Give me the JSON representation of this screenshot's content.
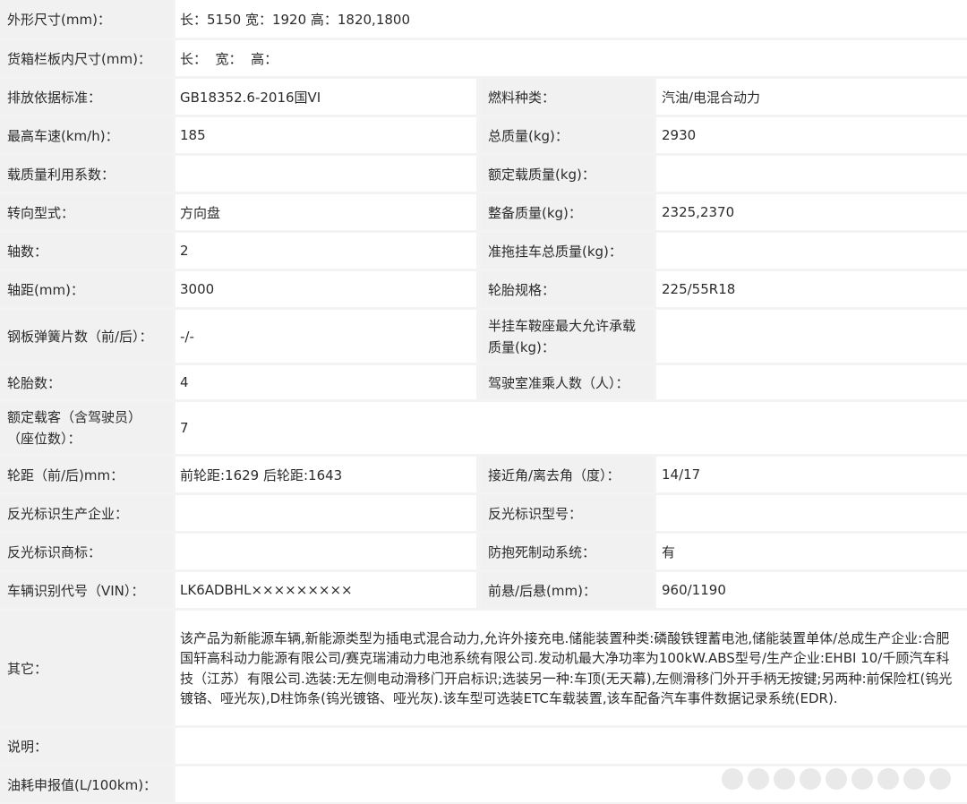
{
  "rows": [
    {
      "label": "外形尺寸(mm)：",
      "value": "长：5150 宽：1920 高：1820,1800"
    },
    {
      "label": "货箱栏板内尺寸(mm)：",
      "value": "长：  宽：  高："
    },
    {
      "label": "排放依据标准：",
      "value": "GB18352.6-2016国VI",
      "label2": "燃料种类：",
      "value2": "汽油/电混合动力"
    },
    {
      "label": "最高车速(km/h)：",
      "value": "185",
      "label2": "总质量(kg)：",
      "value2": "2930"
    },
    {
      "label": "载质量利用系数：",
      "value": "",
      "label2": "额定载质量(kg)：",
      "value2": ""
    },
    {
      "label": "转向型式：",
      "value": "方向盘",
      "label2": "整备质量(kg)：",
      "value2": "2325,2370"
    },
    {
      "label": "轴数：",
      "value": "2",
      "label2": "准拖挂车总质量(kg)：",
      "value2": ""
    },
    {
      "label": "轴距(mm)：",
      "value": "3000",
      "label2": "轮胎规格：",
      "value2": "225/55R18"
    },
    {
      "label": "钢板弹簧片数（前/后）：",
      "value": "-/-",
      "label2": "半挂车鞍座最大允许承载\n质量(kg)：",
      "value2": ""
    },
    {
      "label": "轮胎数：",
      "value": "4",
      "label2": "驾驶室准乘人数（人）：",
      "value2": ""
    },
    {
      "label": "额定载客（含驾驶员）\n（座位数）：",
      "value": "7"
    },
    {
      "label": "轮距（前/后)mm：",
      "value": "前轮距:1629 后轮距:1643",
      "label2": "接近角/离去角（度）：",
      "value2": "14/17"
    },
    {
      "label": "反光标识生产企业：",
      "value": "",
      "label2": "反光标识型号：",
      "value2": ""
    },
    {
      "label": "反光标识商标：",
      "value": "",
      "label2": "防抱死制动系统：",
      "value2": "有"
    },
    {
      "label": "车辆识别代号（VIN）：",
      "value": "LK6ADBHL×××××××××",
      "label2": "前悬/后悬(mm)：",
      "value2": "960/1190"
    },
    {
      "label": "其它：",
      "value": "该产品为新能源车辆,新能源类型为插电式混合动力,允许外接充电.储能装置种类:磷酸铁锂蓄电池,储能装置单体/总成生产企业:合肥国轩高科动力能源有限公司/赛克瑞浦动力电池系统有限公司.发动机最大净功率为100kW.ABS型号/生产企业:EHBI 10/千顾汽车科技（江苏）有限公司.选装:无左侧电动滑移门开启标识;选装另一种:车顶(无天幕),左侧滑移门外开手柄无按键;另两种:前保险杠(钨光镀铬、哑光灰),D柱饰条(钨光镀铬、哑光灰).该车型可选装ETC车载装置,该车配备汽车事件数据记录系统(EDR)."
    },
    {
      "label": "说明：",
      "value": ""
    },
    {
      "label": "油耗申报值(L/100km)：",
      "value": ""
    }
  ]
}
